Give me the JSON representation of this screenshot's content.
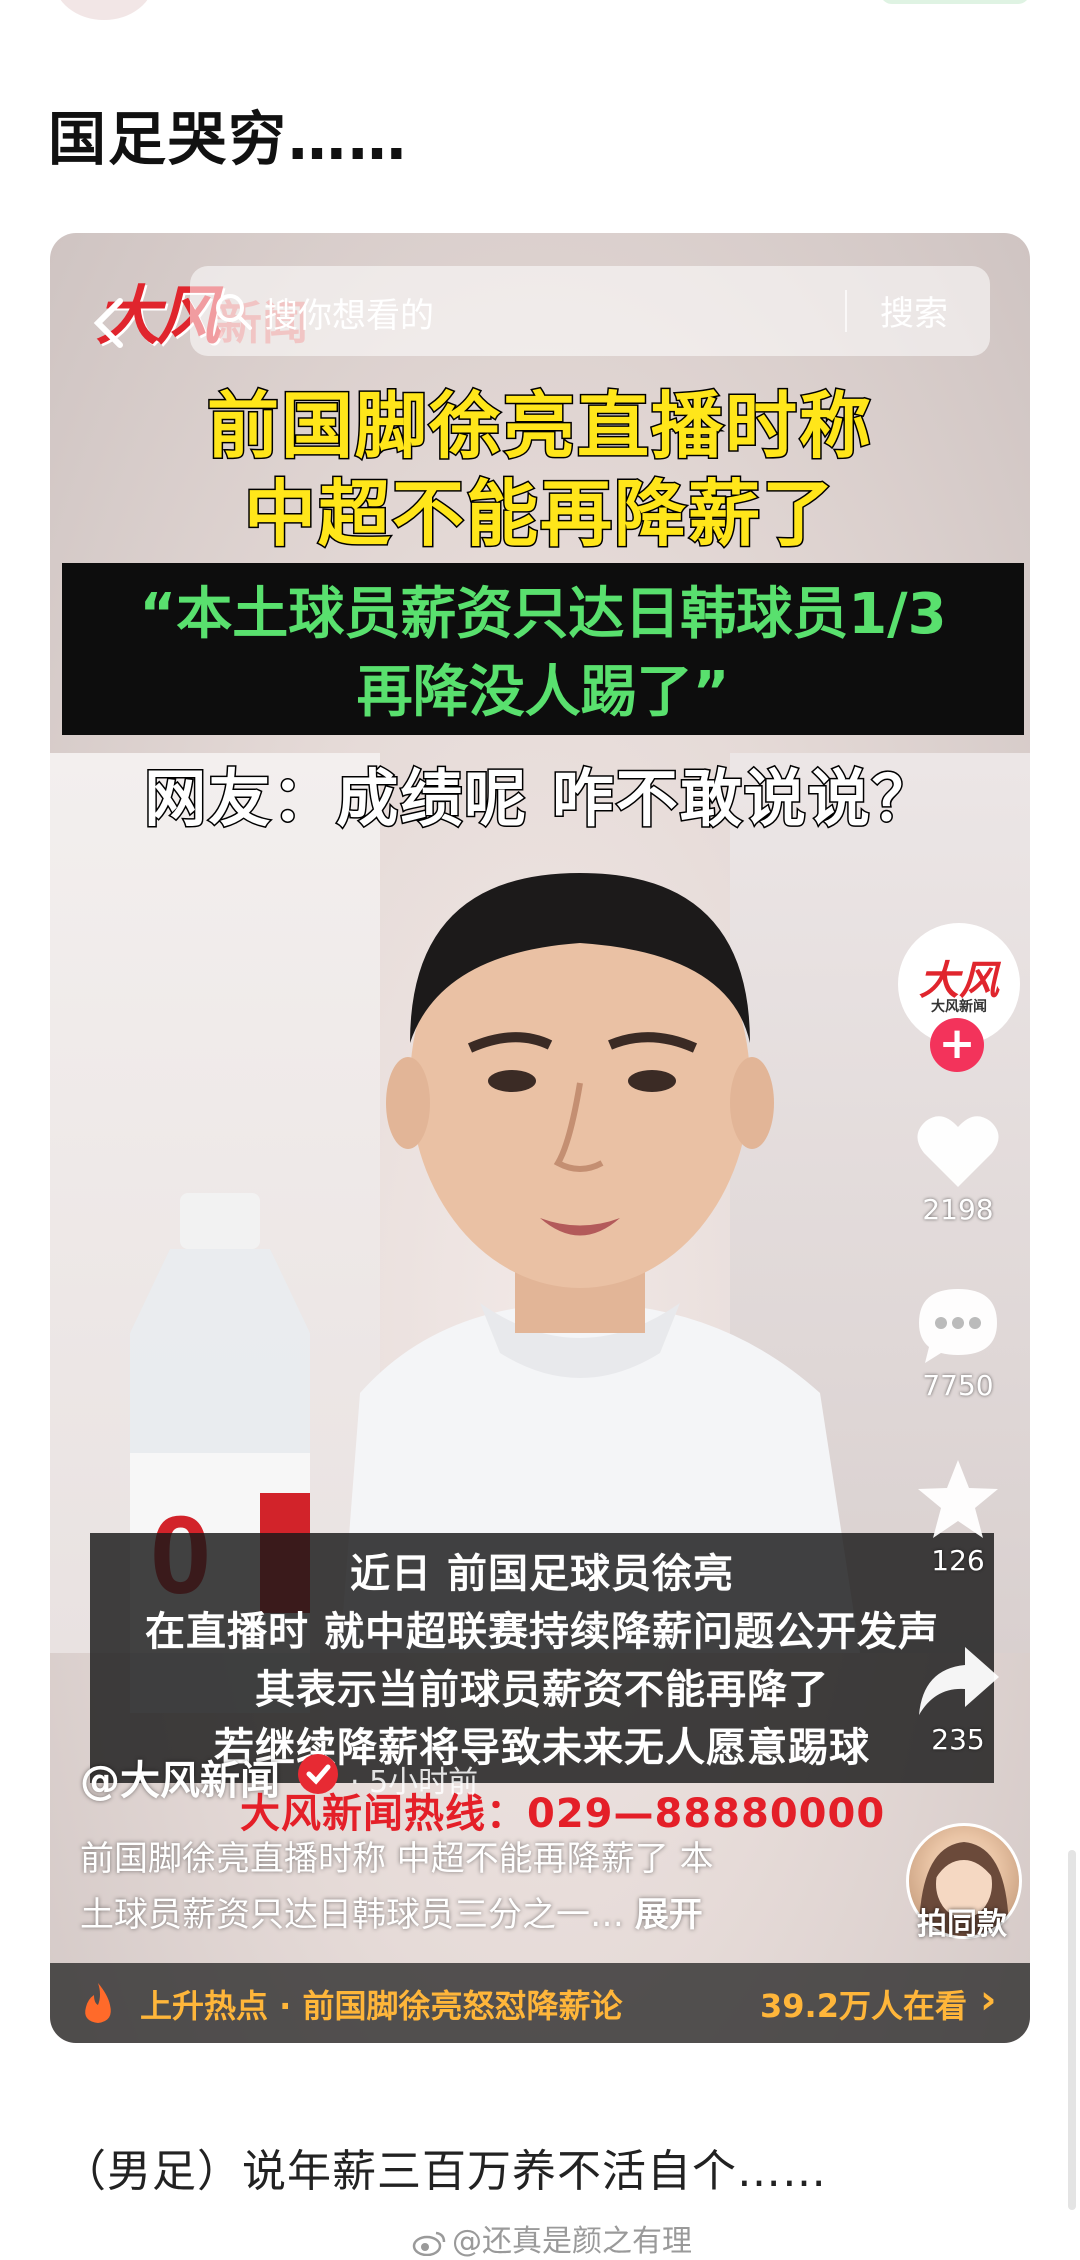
{
  "post": {
    "title": "国足哭穷……",
    "text": "（男足）说年薪三百万养不活自个……",
    "watermark": "@还真是颜之有理"
  },
  "video": {
    "logo_text": "大风",
    "logo_sub": "新闻",
    "search": {
      "placeholder": "搜你想看的",
      "button": "搜索"
    },
    "headline": [
      "前国脚徐亮直播时称",
      "中超不能再降薪了"
    ],
    "quote": [
      "“本土球员薪资只达日韩球员1/3",
      "再降没人踢了”"
    ],
    "netizen": "网友：成绩呢  咋不敢说说？",
    "caption": [
      "近日 前国足球员徐亮",
      "在直播时 就中超联赛持续降薪问题公开发声",
      "其表示当前球员薪资不能再降了",
      "若继续降薪将导致未来无人愿意踢球"
    ],
    "hotline": "大风新闻热线：029—88880000",
    "sidebar": {
      "avatar_text": "大风",
      "avatar_sub": "大风新闻",
      "likes": "2198",
      "comments": "7750",
      "favorites": "126",
      "shares": "235"
    },
    "author": "@大风新闻",
    "time_ago": "· 5小时前",
    "description": [
      "前国脚徐亮直播时称 中超不能再降薪了 本",
      "土球员薪资只达日韩球员三分之一… "
    ],
    "expand": "展开",
    "same_style": "拍同款",
    "hot": {
      "label": "上升热点 · 前国脚徐亮怒怼降薪论",
      "watching": "39.2万人在看"
    },
    "colors": {
      "headline": "#ffe61a",
      "quote": "#59e06e",
      "hotline": "#e41f28",
      "hot": "#ffb63a",
      "follow": "#f3335b"
    }
  }
}
